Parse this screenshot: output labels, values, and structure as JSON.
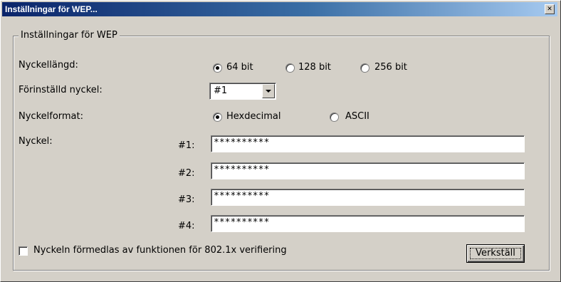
{
  "window": {
    "title": "Inställningar för WEP...",
    "close_glyph": "✕"
  },
  "group": {
    "legend": "Inställningar för WEP"
  },
  "key_length": {
    "label": "Nyckellängd:",
    "options": [
      {
        "label": "64 bit",
        "checked": true
      },
      {
        "label": "128 bit",
        "checked": false
      },
      {
        "label": "256 bit",
        "checked": false
      }
    ]
  },
  "default_key": {
    "label": "Förinställd nyckel:",
    "value": "#1"
  },
  "key_format": {
    "label": "Nyckelformat:",
    "options": [
      {
        "label": "Hexdecimal",
        "checked": true
      },
      {
        "label": "ASCII",
        "checked": false
      }
    ]
  },
  "keys": {
    "label": "Nyckel:",
    "items": [
      {
        "number": "#1:",
        "value": "**********"
      },
      {
        "number": "#2:",
        "value": "**********"
      },
      {
        "number": "#3:",
        "value": "**********"
      },
      {
        "number": "#4:",
        "value": "**********"
      }
    ]
  },
  "dot1x": {
    "label": "Nyckeln förmedlas av funktionen för 802.1x verifiering",
    "checked": false
  },
  "apply_button": {
    "label": "Verkställ"
  }
}
